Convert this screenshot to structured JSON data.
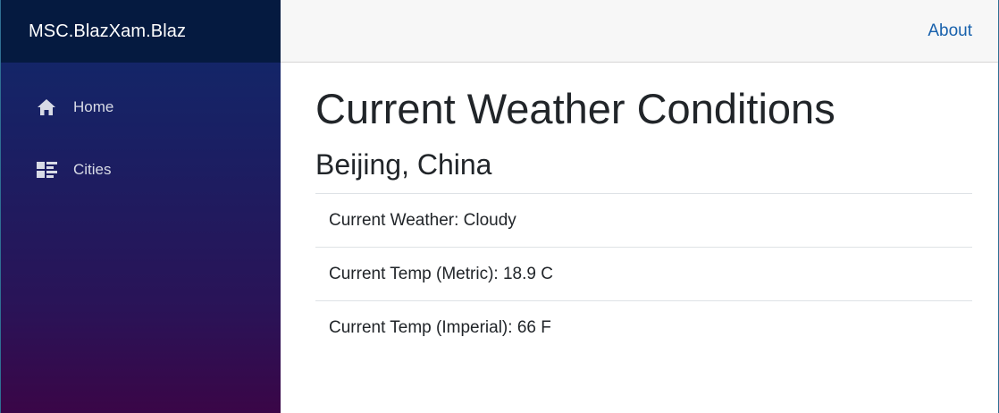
{
  "sidebar": {
    "brand": "MSC.BlazXam.Blaz",
    "items": [
      {
        "label": "Home",
        "icon": "home-icon"
      },
      {
        "label": "Cities",
        "icon": "list-grid-icon"
      }
    ]
  },
  "topbar": {
    "about_label": "About"
  },
  "main": {
    "title": "Current Weather Conditions",
    "location": "Beijing, China",
    "conditions": [
      "Current Weather: Cloudy",
      "Current Temp (Metric): 18.9 C",
      "Current Temp (Imperial): 66 F"
    ]
  },
  "colors": {
    "brand_bar": "#051a40",
    "sidebar_top": "#0f2a6b",
    "sidebar_bottom": "#3a0647",
    "link": "#1861ac",
    "topbar_bg": "#f7f7f7"
  }
}
